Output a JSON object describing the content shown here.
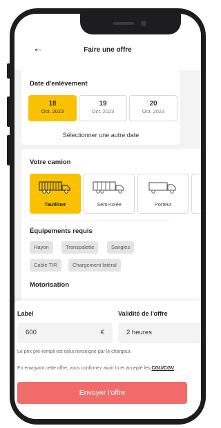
{
  "header": {
    "title": "Faire une offre",
    "back_icon": "←"
  },
  "pickup": {
    "title": "Date d'enlèvement",
    "dates": [
      {
        "day": "18",
        "month": "Oct. 2023",
        "selected": true
      },
      {
        "day": "19",
        "month": "Oct. 2023",
        "selected": false
      },
      {
        "day": "20",
        "month": "Oct. 2023",
        "selected": false
      }
    ],
    "other_date": "Sélectionner une autre date"
  },
  "truck": {
    "title": "Votre camion",
    "types": [
      {
        "label": "Tautliner",
        "selected": true,
        "icon": "tautliner-truck-icon"
      },
      {
        "label": "Semi-tolée",
        "selected": false,
        "icon": "semi-trailer-truck-icon"
      },
      {
        "label": "Porteur",
        "selected": false,
        "icon": "rigid-truck-icon"
      }
    ]
  },
  "equipment": {
    "title": "Équipements requis",
    "items": [
      "Hayon",
      "Transpalette",
      "Sangles",
      "Cable TIR",
      "Chargement latéral"
    ]
  },
  "motorisation": {
    "title": "Motorisation"
  },
  "offer": {
    "label_title": "Label",
    "price_value": "600",
    "currency": "€",
    "validity_title": "Validité de l'offre",
    "validity_value": "2 heures",
    "price_note": "Le prix pré-rempli est celui renseigné par le chargeur.",
    "terms_text": "En envoyant cette offre, vous confirmez avoir lu et accepté les ",
    "terms_link": "CGU/CGV",
    "terms_end": ".",
    "submit_label": "Envoyer l'offre"
  },
  "colors": {
    "accent": "#f9c100",
    "cta": "#f26b6b",
    "frame": "#1d1d1f"
  }
}
